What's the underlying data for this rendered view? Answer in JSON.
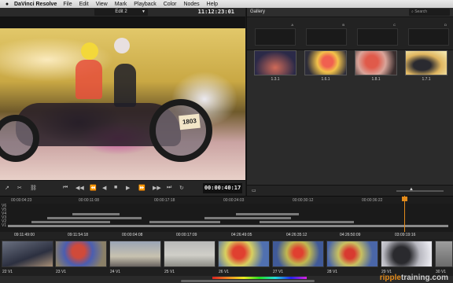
{
  "menubar": {
    "apple": "",
    "app_name": "DaVinci Resolve",
    "items": [
      "File",
      "Edit",
      "View",
      "Mark",
      "Playback",
      "Color",
      "Nodes",
      "Help"
    ]
  },
  "viewer": {
    "clip_selector": "Edit 2",
    "source_timecode": "11:12:23:01",
    "plate_text": "1803",
    "record_timecode": "00:00:40:17"
  },
  "gallery": {
    "title": "Gallery",
    "search_placeholder": "Search",
    "albums": [
      "A",
      "B",
      "C",
      "D"
    ],
    "stills": [
      {
        "label": "1.3.1"
      },
      {
        "label": "1.6.1"
      },
      {
        "label": "1.8.1"
      },
      {
        "label": "1.7.1"
      }
    ]
  },
  "timeline": {
    "ruler": [
      "00:00:04:23",
      "00:00:11:08",
      "00:00:17:18",
      "00:00:24:03",
      "00:00:30:12",
      "00:00:36:22"
    ],
    "tracks": [
      "V6",
      "V5",
      "V4",
      "V3",
      "V2",
      "V1"
    ]
  },
  "clips": [
    {
      "tc": "09:11:49:00",
      "label": "22 V1"
    },
    {
      "tc": "09:11:54:18",
      "label": "23 V1"
    },
    {
      "tc": "00:00:04:08",
      "label": "24 V1"
    },
    {
      "tc": "00:00:17:09",
      "label": "25 V1"
    },
    {
      "tc": "04:26:49:05",
      "label": "26 V1"
    },
    {
      "tc": "04:26:35:12",
      "label": "27 V1"
    },
    {
      "tc": "04:26:50:09",
      "label": "28 V1"
    },
    {
      "tc": "03:09:19:16",
      "label": "29 V1"
    },
    {
      "tc": "",
      "label": "30 V1"
    }
  ],
  "watermark": {
    "prefix": "ripple",
    "suffix": "training.com"
  },
  "colors": {
    "accent": "#e28a1b",
    "panel": "#2b2b2b",
    "background": "#1a1a1a"
  }
}
